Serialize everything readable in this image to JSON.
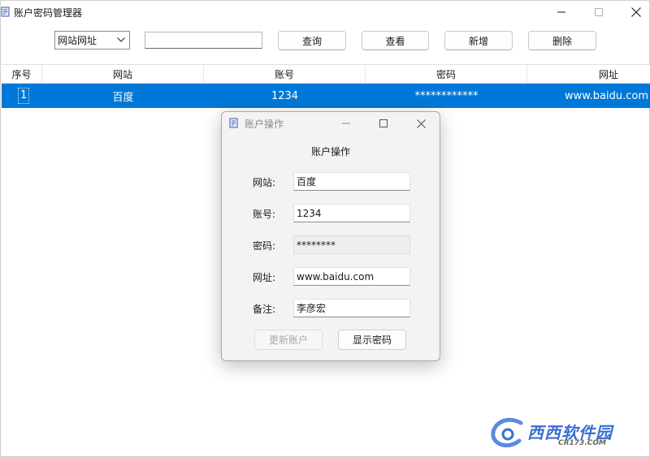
{
  "window": {
    "title": "账户密码管理器"
  },
  "toolbar": {
    "select_value": "网站网址",
    "search_value": "",
    "query_label": "查询",
    "view_label": "查看",
    "add_label": "新增",
    "delete_label": "删除"
  },
  "table": {
    "headers": [
      "序号",
      "网站",
      "账号",
      "密码",
      "网址"
    ],
    "rows": [
      {
        "index": "1",
        "site": "百度",
        "account": "1234",
        "password": "************",
        "url": "www.baidu.com"
      }
    ]
  },
  "dialog": {
    "title": "账户操作",
    "heading": "账户操作",
    "fields": [
      {
        "label": "网站:",
        "value": "百度"
      },
      {
        "label": "账号:",
        "value": "1234"
      },
      {
        "label": "密码:",
        "value": "********"
      },
      {
        "label": "网址:",
        "value": "www.baidu.com"
      },
      {
        "label": "备注:",
        "value": "李彦宏"
      }
    ],
    "update_label": "更新账户",
    "show_password_label": "显示密码"
  },
  "watermark": {
    "text": "西西软件园",
    "sub": "CR173.COM"
  },
  "colors": {
    "selection": "#0078d7",
    "accent": "#3a6fd0"
  }
}
